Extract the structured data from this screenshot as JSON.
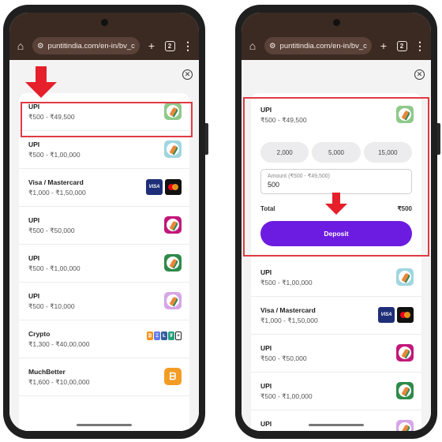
{
  "browser": {
    "url": "puntitindia.com/en-in/bv_c",
    "tab_count": "2"
  },
  "icons": {
    "home": "home-icon",
    "url_settings": "tune-icon",
    "new_tab": "plus-icon",
    "tabs": "tabs-icon",
    "menu": "more-vert-icon",
    "close": "close-circle-icon"
  },
  "colors": {
    "browser_bar": "#3a2a22",
    "highlight": "#e03a45",
    "arrow": "#e5202a",
    "deposit_button": "#6c1ce0"
  },
  "left_list": [
    {
      "title": "UPI",
      "range": "₹500 - ₹49,500",
      "logo": "upi-green-icon",
      "logo_bg": "#8fc98a"
    },
    {
      "title": "UPI",
      "range": "₹500 - ₹1,00,000",
      "logo": "upi-lightblue-icon",
      "logo_bg": "#9fd6df"
    },
    {
      "title": "Visa / Mastercard",
      "range": "₹1,000 - ₹1,50,000",
      "logo": "visa-mastercard-icon"
    },
    {
      "title": "UPI",
      "range": "₹500 - ₹50,000",
      "logo": "upi-magenta-icon",
      "logo_bg": "#c2187a"
    },
    {
      "title": "UPI",
      "range": "₹500 - ₹1,00,000",
      "logo": "upi-darkgreen-icon",
      "logo_bg": "#2f8a4a"
    },
    {
      "title": "UPI",
      "range": "₹500 - ₹10,000",
      "logo": "upi-lilac-icon",
      "logo_bg": "#d7a5e8"
    },
    {
      "title": "Crypto",
      "range": "₹1,300 - ₹40,00,000",
      "logo": "crypto-coins-icon"
    },
    {
      "title": "MuchBetter",
      "range": "₹1,600 - ₹10,00,000",
      "logo": "muchbetter-icon"
    }
  ],
  "crypto_glyphs": [
    "₿",
    "Ξ",
    "Ł",
    "₮",
    "+"
  ],
  "card_labels": {
    "visa": "VISA"
  },
  "expanded": {
    "title": "UPI",
    "range": "₹500 - ₹49,500",
    "chips": [
      "2,000",
      "5,000",
      "15,000"
    ],
    "amount_label": "Amount (₹500 - ₹49,500)",
    "amount_value": "500",
    "total_label": "Total",
    "total_value": "₹500",
    "deposit_label": "Deposit"
  },
  "right_list": [
    {
      "title": "UPI",
      "range": "₹500 - ₹1,00,000",
      "logo": "upi-lightblue-icon",
      "logo_bg": "#9fd6df"
    },
    {
      "title": "Visa / Mastercard",
      "range": "₹1,000 - ₹1,50,000",
      "logo": "visa-mastercard-icon"
    },
    {
      "title": "UPI",
      "range": "₹500 - ₹50,000",
      "logo": "upi-magenta-icon",
      "logo_bg": "#c2187a"
    },
    {
      "title": "UPI",
      "range": "₹500 - ₹1,00,000",
      "logo": "upi-darkgreen-icon",
      "logo_bg": "#2f8a4a"
    },
    {
      "title": "UPI",
      "range": "",
      "logo": "upi-lilac-icon",
      "logo_bg": "#d7a5e8"
    }
  ]
}
